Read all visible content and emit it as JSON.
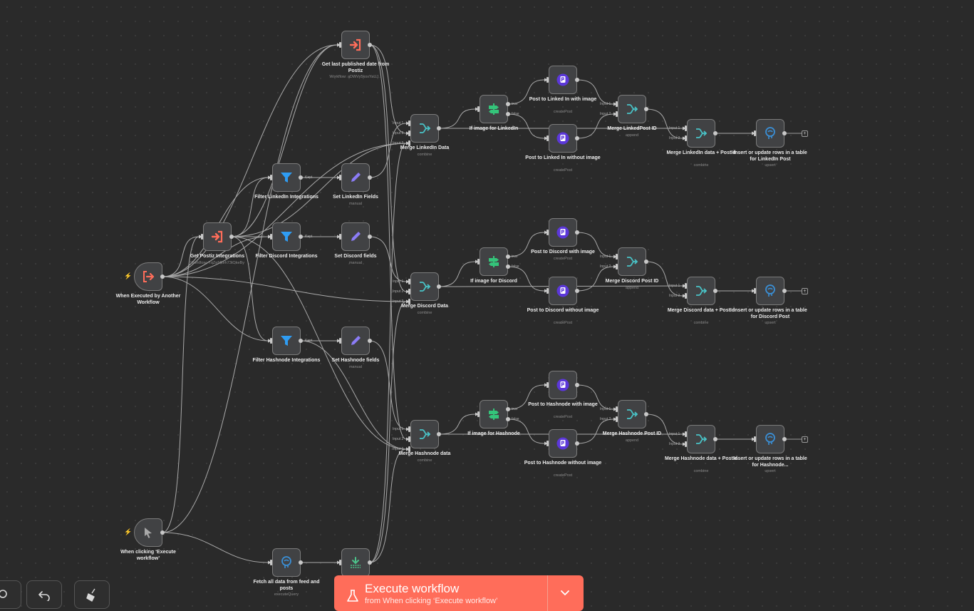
{
  "theme": {
    "accent": "#ff6d5a",
    "background": "#2a2a2a"
  },
  "nodes": [
    {
      "id": "trig1",
      "label": "When Executed by Another Workflow",
      "icon": "exit-arrow-icon",
      "trigger": true
    },
    {
      "id": "trig2",
      "label": "When clicking ‘Execute workflow’",
      "icon": "cursor-icon",
      "trigger": true
    },
    {
      "id": "getint",
      "label": "Get Postiz Integrations",
      "sub": "Workflow: TqZeMkeh73tOkeBy",
      "icon": "execute-workflow-icon"
    },
    {
      "id": "getlast",
      "label": "Get last published date from Postiz",
      "sub": "Workflow: aDWVy5koxYaUJ...",
      "icon": "execute-workflow-icon"
    },
    {
      "id": "fli",
      "label": "Filter LinkedIn Integrations",
      "icon": "filter-icon"
    },
    {
      "id": "fdi",
      "label": "Filter Discord Integrations",
      "icon": "filter-icon"
    },
    {
      "id": "fhi",
      "label": "Filter Hashnode Integrations",
      "icon": "filter-icon"
    },
    {
      "id": "sli",
      "label": "Set LinkedIn Fields",
      "sub": "manual",
      "icon": "pencil-icon"
    },
    {
      "id": "sdi",
      "label": "Set Discord fields",
      "sub": "manual",
      "icon": "pencil-icon"
    },
    {
      "id": "shi",
      "label": "Set Hashnode fields",
      "sub": "manual",
      "icon": "pencil-icon"
    },
    {
      "id": "fetch",
      "label": "Fetch all data from feed and posts",
      "sub": "executeQuery",
      "icon": "postgres-icon"
    },
    {
      "id": "dl",
      "label": "",
      "icon": "download-icon"
    },
    {
      "id": "mli",
      "label": "Merge LinkedIn Data",
      "sub": "combine",
      "icon": "merge-icon"
    },
    {
      "id": "mdi",
      "label": "Merge Discord Data",
      "sub": "combine",
      "icon": "merge-icon"
    },
    {
      "id": "mhi",
      "label": "Merge Hashnode data",
      "sub": "combine",
      "icon": "merge-icon"
    },
    {
      "id": "ifli",
      "label": "If image for LinkedIn",
      "icon": "if-icon"
    },
    {
      "id": "ifdi",
      "label": "If image for Discord",
      "icon": "if-icon"
    },
    {
      "id": "ifhi",
      "label": "If image for Hashnode",
      "icon": "if-icon"
    },
    {
      "id": "pli1",
      "label": "Post to Linked In with image",
      "sub": "createPost",
      "icon": "postiz-icon"
    },
    {
      "id": "pli2",
      "label": "Post to Linked In without image",
      "sub": "createPost",
      "icon": "postiz-icon"
    },
    {
      "id": "pdi1",
      "label": "Post to Discord with image",
      "sub": "createPost",
      "icon": "postiz-icon"
    },
    {
      "id": "pdi2",
      "label": "Post to Discord without image",
      "sub": "createPost",
      "icon": "postiz-icon"
    },
    {
      "id": "phi1",
      "label": "Post to Hashnode with image",
      "sub": "createPost",
      "icon": "postiz-icon"
    },
    {
      "id": "phi2",
      "label": "Post to Hashnode without image",
      "sub": "createPost",
      "icon": "postiz-icon"
    },
    {
      "id": "mlp",
      "label": "Merge LinkedPost ID",
      "sub": "append",
      "icon": "merge-icon"
    },
    {
      "id": "mdp",
      "label": "Merge Discord Post ID",
      "sub": "append",
      "icon": "merge-icon"
    },
    {
      "id": "mhp",
      "label": "Merge Hashnode Post ID",
      "sub": "append",
      "icon": "merge-icon"
    },
    {
      "id": "mlf",
      "label": "Merge LinkedIn data + PostId",
      "sub": "combine",
      "icon": "merge-icon"
    },
    {
      "id": "mdf",
      "label": "Merge Discord data + PostId",
      "sub": "combine",
      "icon": "merge-icon"
    },
    {
      "id": "mhf",
      "label": "Merge Hashnode data + PostId",
      "sub": "combine",
      "icon": "merge-icon"
    },
    {
      "id": "upl",
      "label": "Insert or update rows in a table for LinkedIn Post",
      "sub": "upsert",
      "icon": "postgres-icon"
    },
    {
      "id": "upd",
      "label": "Insert or update rows in a table for Discord Post",
      "sub": "upsert",
      "icon": "postgres-icon"
    },
    {
      "id": "uph",
      "label": "Insert or update rows in a table for Hashnode...",
      "sub": "upsert",
      "icon": "postgres-icon"
    }
  ],
  "port_labels": {
    "kept": "Kept",
    "true": "true",
    "false": "false",
    "input1": "Input 1",
    "input2": "Input 2",
    "input3": "Input 3"
  },
  "execute_button": {
    "label": "Execute workflow",
    "sub": "from When clicking ‘Execute workflow’"
  },
  "toolbar": {
    "zoom_icon": "zoom-icon",
    "undo_icon": "undo-icon",
    "cleanup_icon": "broom-icon"
  }
}
